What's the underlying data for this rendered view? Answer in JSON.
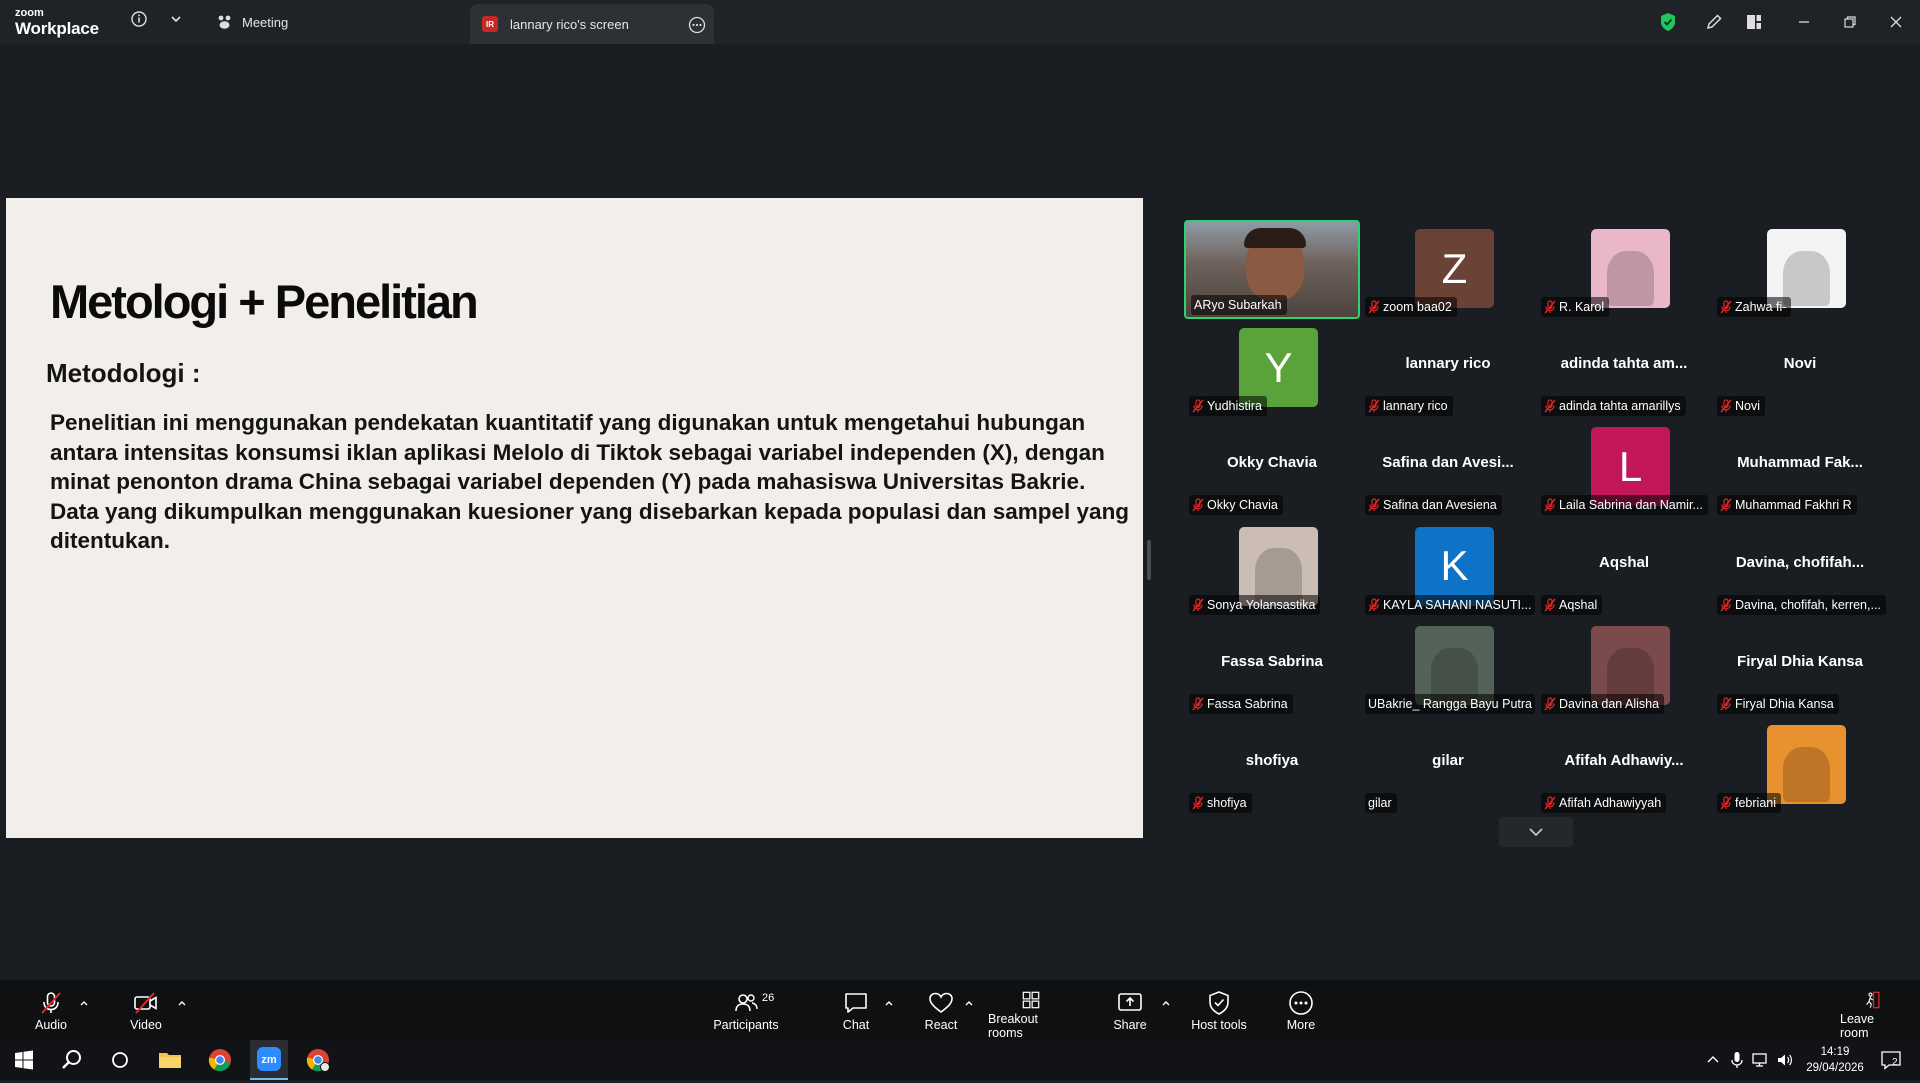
{
  "titlebar": {
    "logo_top": "zoom",
    "logo_bottom": "Workplace",
    "meeting_tab": "Meeting",
    "screen_tab": "lannary rico's screen",
    "screen_tab_badge": "IR"
  },
  "slide": {
    "title": "Metologi + Penelitian",
    "subtitle": "Metodologi :",
    "body": "Penelitian ini menggunakan pendekatan kuantitatif yang digunakan untuk mengetahui hubungan antara intensitas konsumsi iklan aplikasi Melolo di Tiktok sebagai variabel independen (X), dengan minat penonton drama China sebagai variabel dependen (Y) pada mahasiswa Universitas Bakrie. Data yang dikumpulkan menggunakan kuesioner yang disebarkan kepada populasi dan sampel yang ditentukan."
  },
  "participants": [
    {
      "label": "ARyo Subarkah",
      "kind": "video",
      "muted": false,
      "active": true
    },
    {
      "label": "zoom baa02",
      "kind": "letter",
      "letter": "Z",
      "color": "#6b4236",
      "muted": true
    },
    {
      "label": "R. Karol",
      "kind": "image",
      "color": "#e9b7c8",
      "muted": true
    },
    {
      "label": "Zahwa fi-",
      "kind": "image",
      "color": "#f4f4f4",
      "muted": true
    },
    {
      "label": "Yudhistira",
      "kind": "letter",
      "letter": "Y",
      "color": "#5aa23a",
      "muted": true
    },
    {
      "label": "lannary rico",
      "kind": "name",
      "display": "lannary rico",
      "muted": true
    },
    {
      "label": "adinda tahta amarillys",
      "kind": "name",
      "display": "adinda tahta am...",
      "muted": true
    },
    {
      "label": "Novi",
      "kind": "name",
      "display": "Novi",
      "muted": true
    },
    {
      "label": "Okky Chavia",
      "kind": "name",
      "display": "Okky Chavia",
      "muted": true
    },
    {
      "label": "Safina dan Avesiena",
      "kind": "name",
      "display": "Safina dan Avesi...",
      "muted": true
    },
    {
      "label": "Laila Sabrina dan Namir...",
      "kind": "letter",
      "letter": "L",
      "color": "#c2185b",
      "muted": true
    },
    {
      "label": "Muhammad Fakhri R",
      "kind": "name",
      "display": "Muhammad Fak...",
      "muted": true
    },
    {
      "label": "Sonya Yolansastika",
      "kind": "image",
      "color": "#cbbdb3",
      "muted": true
    },
    {
      "label": "KAYLA SAHANI NASUTI...",
      "kind": "letter",
      "letter": "K",
      "color": "#0e72c7",
      "muted": true
    },
    {
      "label": "Aqshal",
      "kind": "name",
      "display": "Aqshal",
      "muted": true
    },
    {
      "label": "Davina, chofifah, kerren,...",
      "kind": "name",
      "display": "Davina, chofifah...",
      "muted": true
    },
    {
      "label": "Fassa Sabrina",
      "kind": "name",
      "display": "Fassa Sabrina",
      "muted": true
    },
    {
      "label": "UBakrie_ Rangga Bayu Putra",
      "kind": "image",
      "color": "#55625a",
      "muted": false
    },
    {
      "label": "Davina dan Alisha",
      "kind": "image",
      "color": "#7b4a4c",
      "muted": true
    },
    {
      "label": "Firyal Dhia Kansa",
      "kind": "name",
      "display": "Firyal Dhia Kansa",
      "muted": true
    },
    {
      "label": "shofiya",
      "kind": "name",
      "display": "shofiya",
      "muted": true
    },
    {
      "label": "gilar",
      "kind": "name",
      "display": "gilar",
      "muted": false
    },
    {
      "label": "Afifah Adhawiyyah",
      "kind": "name",
      "display": "Afifah Adhawiy...",
      "muted": true
    },
    {
      "label": "febriani",
      "kind": "image",
      "color": "#e8912f",
      "muted": true
    }
  ],
  "toolbar": {
    "audio": "Audio",
    "video": "Video",
    "participants": "Participants",
    "participants_count": "26",
    "chat": "Chat",
    "react": "React",
    "breakout": "Breakout rooms",
    "share": "Share",
    "host_tools": "Host tools",
    "more": "More",
    "leave": "Leave room"
  },
  "taskbar": {
    "time": "14:19",
    "date": "29/04/2026",
    "notifications": "2"
  },
  "colors": {
    "active_speaker": "#2bd46f",
    "muted_red": "#e02828",
    "shield_green": "#22c55e"
  }
}
